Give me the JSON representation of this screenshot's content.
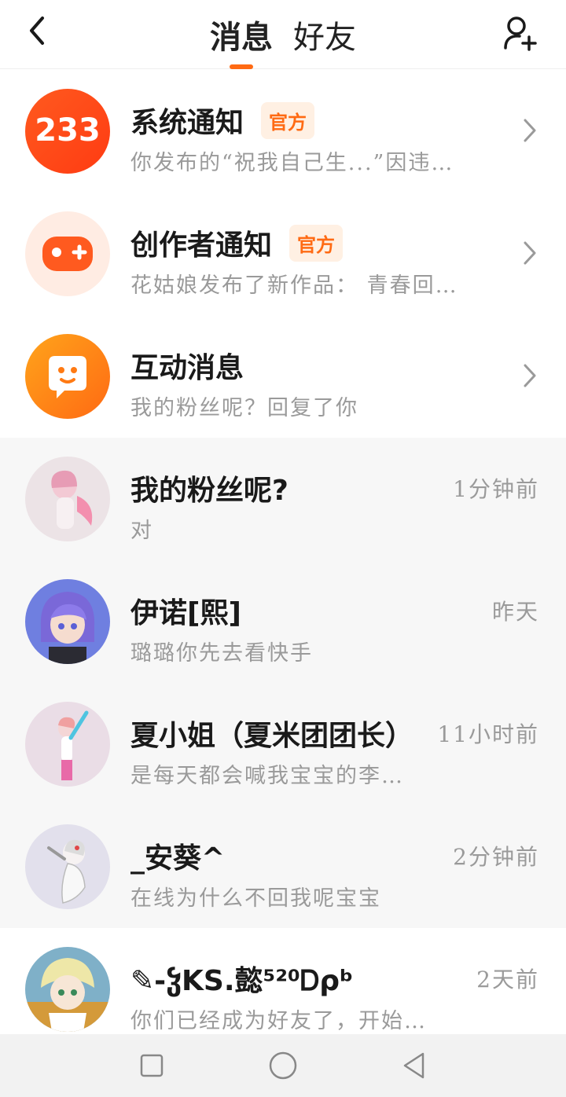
{
  "header": {
    "tabs": [
      {
        "label": "消息",
        "active": true
      },
      {
        "label": "好友",
        "active": false
      }
    ],
    "back_icon": "chevron-left-icon",
    "add_friend_icon": "add-user-icon"
  },
  "colors": {
    "accent": "#ff6a13",
    "badge_bg": "#fff0e3",
    "row_gray": "#f7f7f7"
  },
  "notifications": [
    {
      "title": "系统通知",
      "badge": "官方",
      "preview": "你发布的“祝我自己生...”因违…",
      "icon": "233-logo-icon"
    },
    {
      "title": "创作者通知",
      "badge": "官方",
      "preview": "花姑娘发布了新作品：  青春回…",
      "icon": "gamepad-icon"
    },
    {
      "title": "互动消息",
      "badge": "",
      "preview": "我的粉丝呢？回复了你",
      "icon": "chat-bubble-icon"
    }
  ],
  "chats": [
    {
      "name": "我的粉丝呢?",
      "preview": "对",
      "time": "1分钟前"
    },
    {
      "name": "伊诺[熙]",
      "preview": "璐璐你先去看快手",
      "time": "昨天"
    },
    {
      "name": "夏小姐（夏米团团长）",
      "preview": "是每天都会喊我宝宝的李…",
      "time": "11小时前"
    },
    {
      "name": "_安葵^",
      "preview": "在线为什么不回我呢宝宝",
      "time": "2分钟前"
    },
    {
      "name": "✎-ჴKS.懿⁵²⁰Ꭰρᵇ",
      "preview": "你们已经成为好友了，开始…",
      "time": "2天前"
    }
  ],
  "navbar": {
    "items": [
      "square-icon",
      "circle-icon",
      "triangle-back-icon"
    ]
  }
}
